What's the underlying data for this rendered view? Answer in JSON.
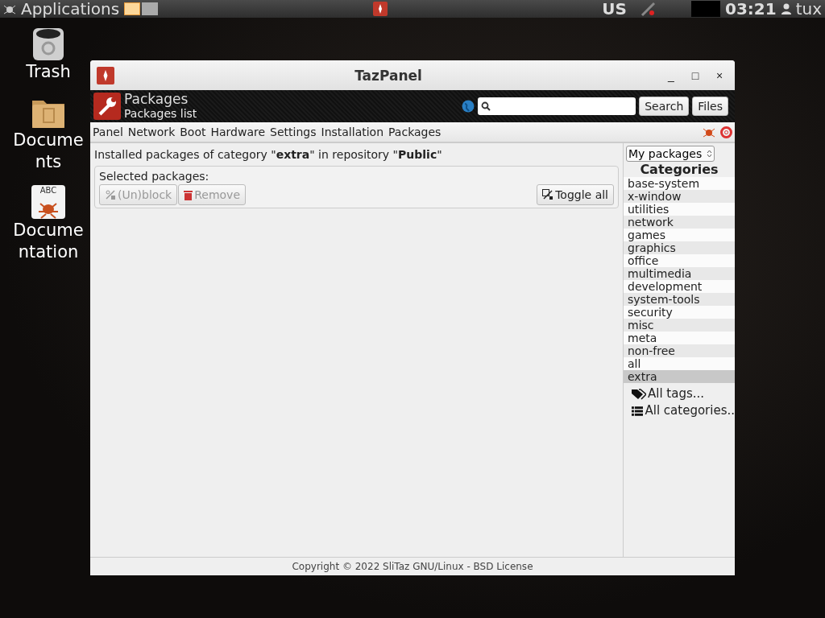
{
  "taskbar": {
    "menu": "Applications",
    "workspaces": [
      {
        "selected": true
      },
      {
        "selected": false
      }
    ],
    "keyboard": "US",
    "clock": "03:21",
    "user": "tux"
  },
  "desktop_icons": [
    {
      "kind": "trash",
      "label": "Trash"
    },
    {
      "kind": "folder",
      "label": "Documents"
    },
    {
      "kind": "doc",
      "label": "Documentation",
      "badge": "ABC"
    }
  ],
  "window": {
    "title": "TazPanel",
    "controls": [
      "_",
      "□",
      "×"
    ]
  },
  "header": {
    "title": "Packages",
    "subtitle": "Packages list",
    "search_button": "Search",
    "files_button": "Files"
  },
  "menu": [
    "Panel",
    "Network",
    "Boot",
    "Hardware",
    "Settings",
    "Installation",
    "Packages"
  ],
  "info": "Installed packages of category \"**extra**\" in repository \"**Public**\"",
  "selected_box": {
    "label": "Selected packages:",
    "buttons": [
      {
        "kind": "unblock",
        "label": "(Un)block",
        "disabled": true
      },
      {
        "kind": "remove",
        "label": "Remove",
        "disabled": true
      }
    ],
    "toggle": "Toggle all"
  },
  "sidebar": {
    "select": "My packages",
    "heading": "Categories",
    "categories": [
      {
        "label": "base-system",
        "selected": false
      },
      {
        "label": "x-window",
        "selected": false
      },
      {
        "label": "utilities",
        "selected": false
      },
      {
        "label": "network",
        "selected": false
      },
      {
        "label": "games",
        "selected": false
      },
      {
        "label": "graphics",
        "selected": false
      },
      {
        "label": "office",
        "selected": false
      },
      {
        "label": "multimedia",
        "selected": false
      },
      {
        "label": "development",
        "selected": false
      },
      {
        "label": "system-tools",
        "selected": false
      },
      {
        "label": "security",
        "selected": false
      },
      {
        "label": "misc",
        "selected": false
      },
      {
        "label": "meta",
        "selected": false
      },
      {
        "label": "non-free",
        "selected": false
      },
      {
        "label": "all",
        "selected": false
      },
      {
        "label": "extra",
        "selected": true
      }
    ],
    "links": [
      {
        "kind": "tags",
        "label": "All tags..."
      },
      {
        "kind": "list",
        "label": "All categories.."
      }
    ]
  },
  "footer": "Copyright © 2022 SliTaz GNU/Linux - BSD License"
}
